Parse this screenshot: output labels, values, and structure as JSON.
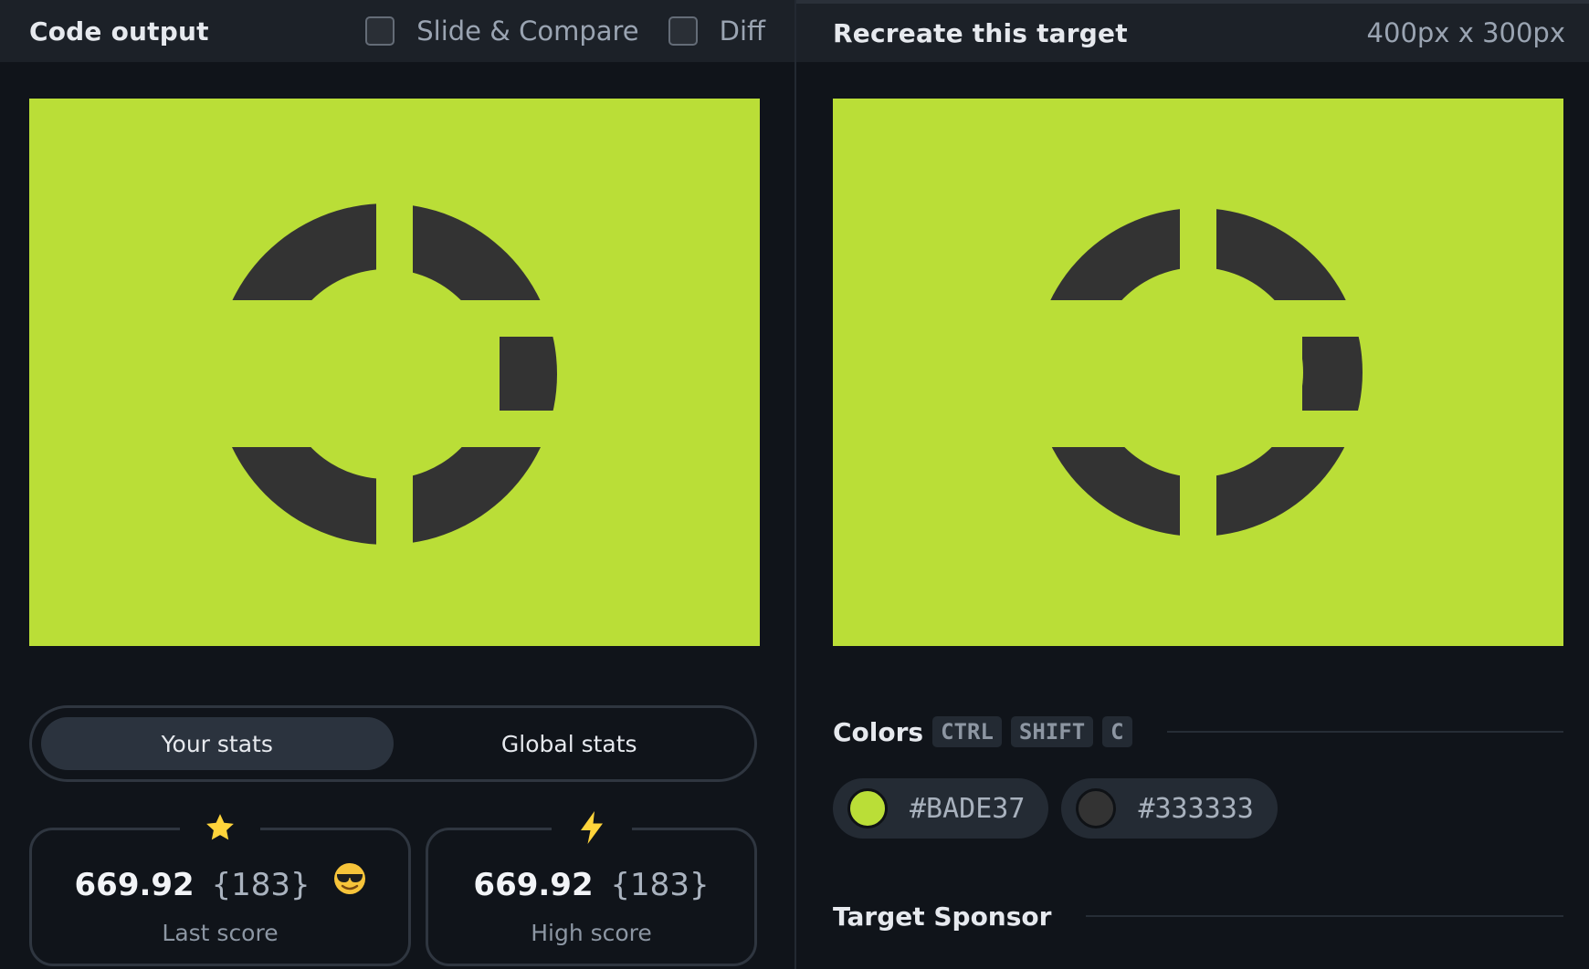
{
  "left_panel": {
    "title": "Code output",
    "toggles": [
      {
        "label": "Slide & Compare",
        "checked": false
      },
      {
        "label": "Diff",
        "checked": false
      }
    ]
  },
  "right_panel": {
    "title": "Recreate this target",
    "dimensions": "400px x 300px"
  },
  "canvas": {
    "background": "#BADE37",
    "shape_color": "#333333"
  },
  "stats": {
    "tabs": [
      {
        "label": "Your stats",
        "active": true
      },
      {
        "label": "Global stats",
        "active": false
      }
    ],
    "cards": [
      {
        "icon": "star-icon",
        "score": "669.92",
        "rank": "{183}",
        "label": "Last score",
        "emoji": "sunglasses-emoji-icon"
      },
      {
        "icon": "lightning-icon",
        "score": "669.92",
        "rank": "{183}",
        "label": "High score"
      }
    ]
  },
  "colors": {
    "title": "Colors",
    "shortcut": [
      "CTRL",
      "SHIFT",
      "C"
    ],
    "swatches": [
      {
        "hex": "#BADE37"
      },
      {
        "hex": "#333333"
      }
    ]
  },
  "sponsor": {
    "title": "Target Sponsor"
  }
}
